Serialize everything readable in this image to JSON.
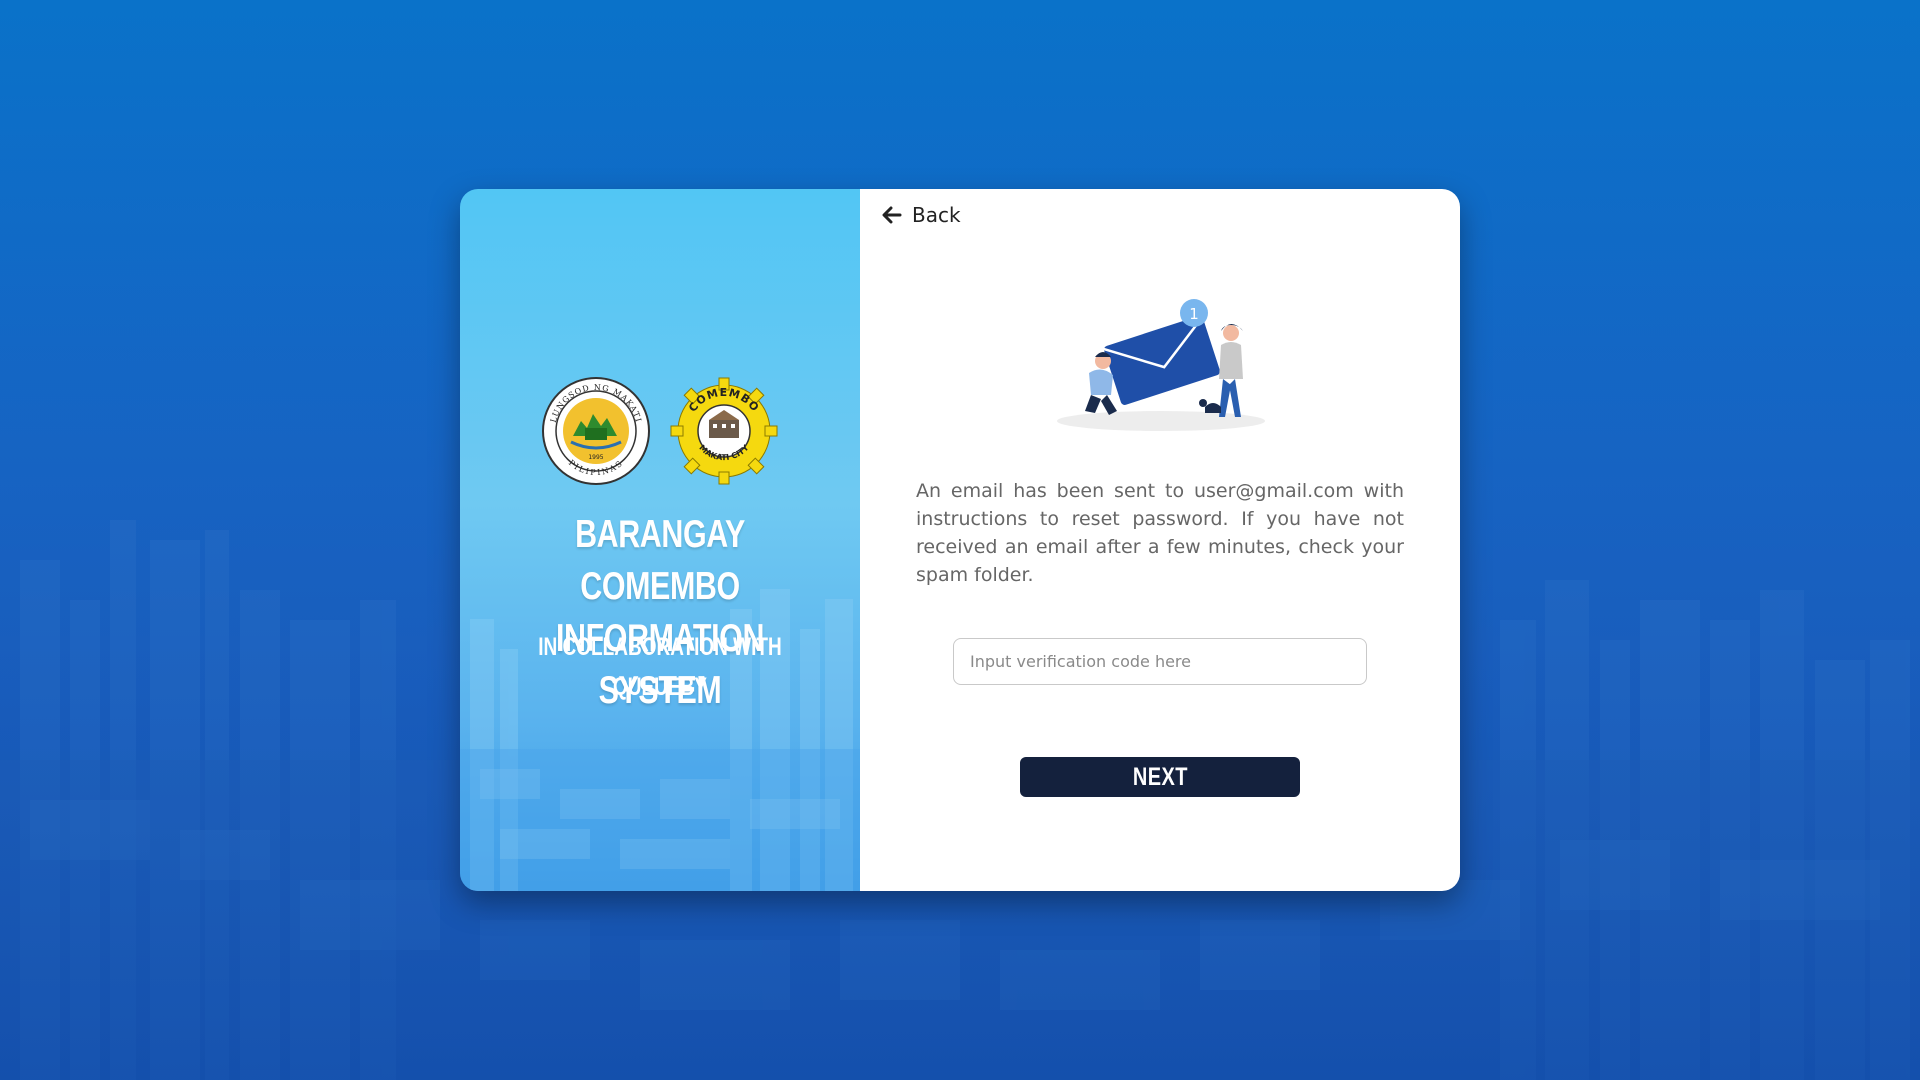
{
  "colors": {
    "background": "#1366c4",
    "left_panel": "#5ab8f0",
    "button_bg": "#14213d",
    "button_text": "#ffffff",
    "text_muted": "#666666",
    "envelope": "#1f4fa8"
  },
  "left_panel": {
    "logo_makati": {
      "icon": "makati-seal-icon",
      "ring_text": "LUNGSOD NG MAKATI",
      "bottom_text": "PILIPINAS",
      "year": "1995"
    },
    "logo_comembo": {
      "icon": "comembo-seal-icon",
      "ring_text": "COMEMBO",
      "bottom_text": "MAKATI CITY"
    },
    "title_line1": "BARANGAY COMEMBO",
    "title_line2": "INFORMATION SYSTEM",
    "subtitle_line1": "IN COLLABORATION WITH",
    "subtitle_line2": "QUEUEBY"
  },
  "right_panel": {
    "back_label": "Back",
    "back_icon": "arrow-left-icon",
    "illustration": {
      "icon": "email-sent-illustration",
      "badge": "1"
    },
    "message": "An email has been sent to user@gmail.com with instructions to reset password. If you have not received an email after a few minutes, check your spam folder.",
    "code_input": {
      "value": "",
      "placeholder": "Input verification code here"
    },
    "next_label": "NEXT"
  }
}
